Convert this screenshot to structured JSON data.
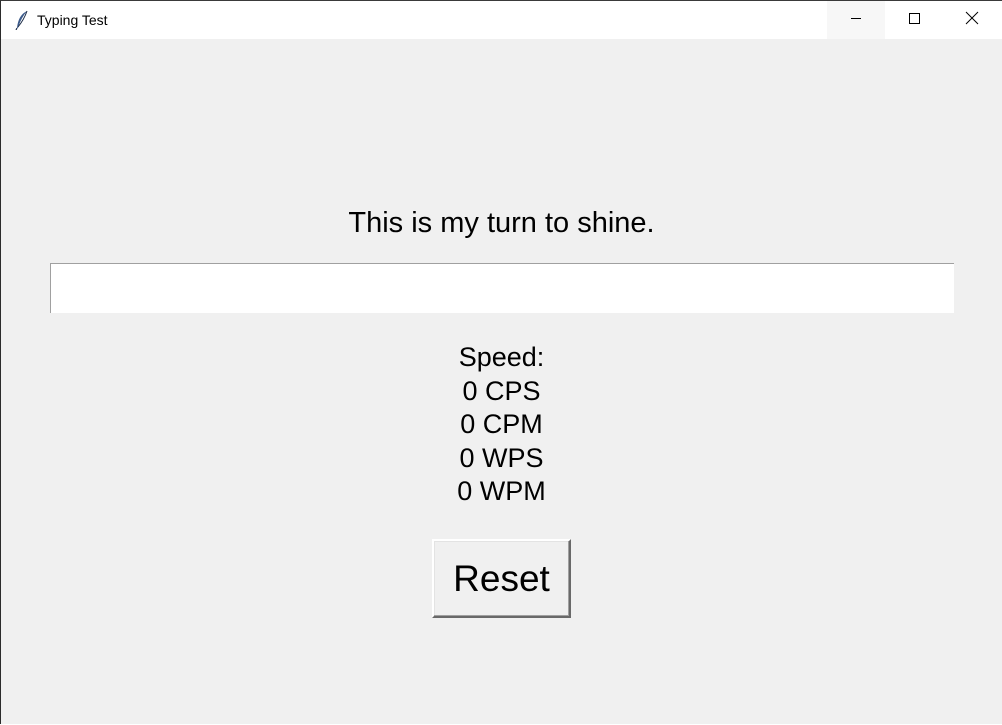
{
  "window": {
    "title": "Typing Test",
    "icon": "feather-icon",
    "controls": {
      "minimize": "minimize-icon",
      "maximize": "maximize-icon",
      "close": "close-icon"
    }
  },
  "test": {
    "sentence": "This is my turn to shine.",
    "input_value": ""
  },
  "speed": {
    "heading": "Speed:",
    "cps": "0 CPS",
    "cpm": "0 CPM",
    "wps": "0 WPS",
    "wpm": "0 WPM"
  },
  "reset": {
    "label": "Reset"
  }
}
